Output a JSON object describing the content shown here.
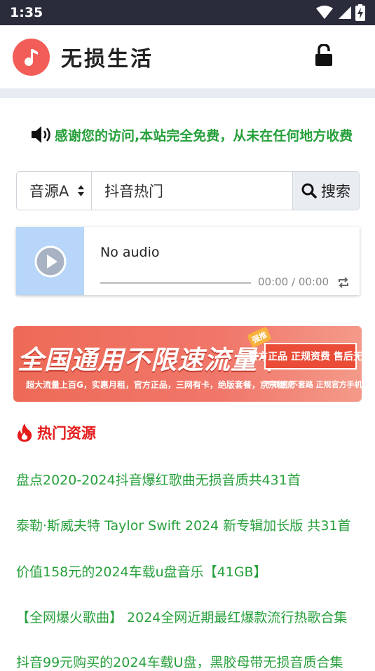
{
  "status_bar": {
    "time": "1:35",
    "icons": [
      "wifi-icon",
      "signal-icon",
      "battery-charging-icon"
    ]
  },
  "header": {
    "app_title": "无损生活",
    "logo_icon": "music-note-icon",
    "lock_icon": "unlock-icon"
  },
  "notice": {
    "text": "感谢您的访问,本站完全免费，从未在任何地方收费",
    "icon": "speaker-icon"
  },
  "search": {
    "source_selected": "音源A",
    "value": "抖音热门",
    "button_label": "搜索"
  },
  "player": {
    "title": "No audio",
    "time": "00:00 / 00:00"
  },
  "banner": {
    "headline": "全国通用不限速流量卡",
    "subline": "超大流量上百G，实惠月租，官方正品，三网有卡，绝版套餐，京东物流",
    "box_text": "官方正品 正规资费 售后无忧",
    "box_subline": "不限速 不套路 正规官方手机卡",
    "tag": "强推"
  },
  "hot": {
    "title": "热门资源",
    "items": [
      "盘点2020-2024抖音爆红歌曲无损音质共431首",
      "泰勒·斯威夫特 Taylor Swift 2024 新专辑加长版 共31首",
      "价值158元的2024车载u盘音乐【41GB】",
      "【全网爆火歌曲】 2024全网近期最红爆款流行热歌合集",
      "抖音99元购买的2024车载U盘，黑胶母带无损音质合集"
    ]
  },
  "colors": {
    "accent_green": "#27a03b",
    "hot_red": "#e41b1b",
    "logo_red": "#f25d57",
    "status_bar": "#2a2c3b"
  }
}
